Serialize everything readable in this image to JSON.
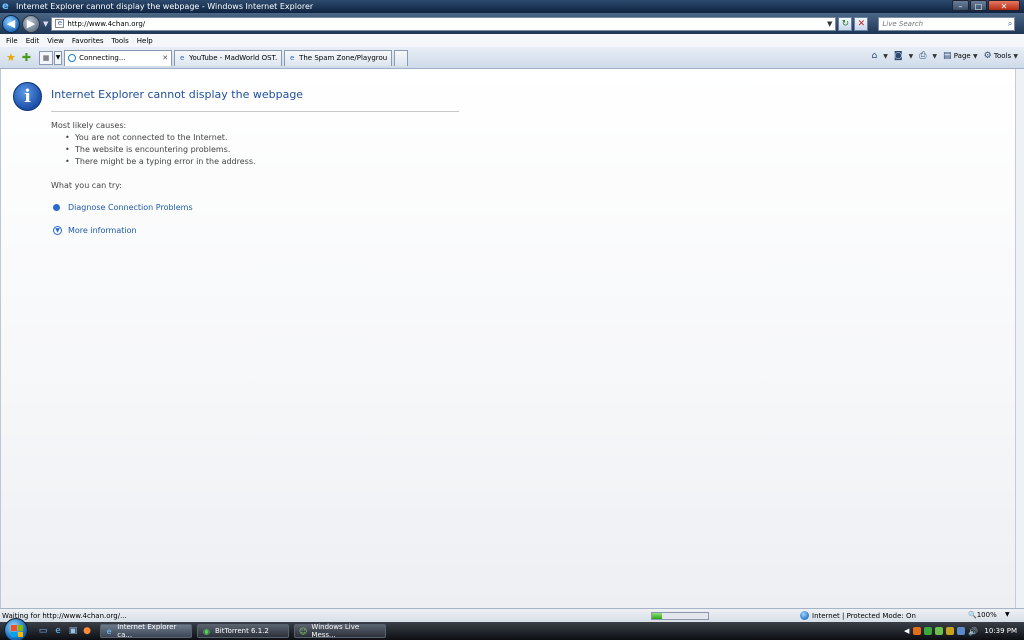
{
  "window": {
    "title": "Internet Explorer cannot display the webpage - Windows Internet Explorer",
    "controls": {
      "minimize": "–",
      "maximize": "□",
      "close": "✕"
    }
  },
  "address_bar": {
    "url": "http://www.4chan.org/",
    "search_placeholder": "Live Search"
  },
  "menu": {
    "items": [
      "File",
      "Edit",
      "View",
      "Favorites",
      "Tools",
      "Help"
    ]
  },
  "tabs": [
    {
      "label": "Connecting...",
      "active": true,
      "icon": "loading-icon"
    },
    {
      "label": "YouTube - MadWorld OST...",
      "active": false,
      "icon": "ie-page-icon"
    },
    {
      "label": "The Spam Zone/Playgrou...",
      "active": false,
      "icon": "ie-page-icon"
    }
  ],
  "command_bar": {
    "page_label": "Page",
    "tools_label": "Tools"
  },
  "error_page": {
    "title": "Internet Explorer cannot display the webpage",
    "causes_heading": "Most likely causes:",
    "causes": [
      "You are not connected to the Internet.",
      "The website is encountering problems.",
      "There might be a typing error in the address."
    ],
    "try_heading": "What you can try:",
    "diagnose_link": "Diagnose Connection Problems",
    "more_info_link": "More information"
  },
  "status_bar": {
    "text": "Waiting for http://www.4chan.org/...",
    "progress_fraction": 0.18,
    "zone": "Internet | Protected Mode: On",
    "zoom": "100%"
  },
  "taskbar": {
    "buttons": [
      {
        "label": "Internet Explorer ca...",
        "active": true,
        "icon": "ie-icon"
      },
      {
        "label": "BitTorrent 6.1.2",
        "active": false,
        "icon": "bittorrent-icon"
      },
      {
        "label": "Windows Live Mess...",
        "active": false,
        "icon": "messenger-icon"
      }
    ],
    "clock": "10:39 PM"
  },
  "colors": {
    "link": "#1e5aa8",
    "title_blue": "#1e4f9c",
    "progress_green": "#2da21a"
  }
}
